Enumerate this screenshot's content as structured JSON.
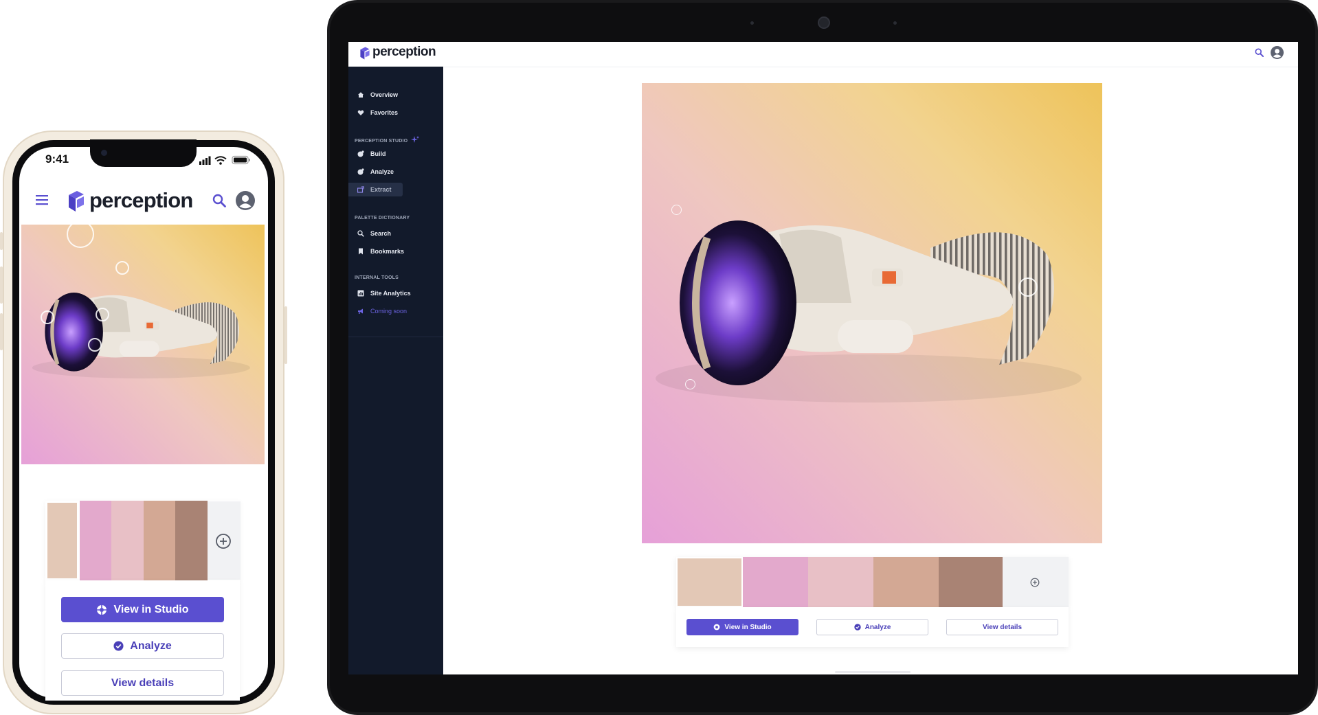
{
  "phone": {
    "status_time": "9:41",
    "brand": "perception",
    "icons": {
      "menu": "hamburger-menu-icon",
      "search": "search-icon",
      "avatar": "user-avatar-icon"
    },
    "palette": [
      "#e3c8b6",
      "#e3a9cc",
      "#e8c0c6",
      "#d3a894",
      "#a98374"
    ],
    "add_swatch_icon": "plus-circle-icon",
    "buttons": {
      "view_in_studio": "View in Studio",
      "analyze": "Analyze",
      "view_details": "View details"
    }
  },
  "tablet": {
    "brand": "perception",
    "icons": {
      "search": "search-icon",
      "avatar": "user-avatar-icon"
    },
    "sidebar": {
      "top_items": [
        {
          "label": "Overview",
          "icon": "home-icon"
        },
        {
          "label": "Favorites",
          "icon": "heart-icon"
        }
      ],
      "studio_section": "PERCEPTION STUDIO",
      "studio_items": [
        {
          "label": "Build",
          "icon": "palette-icon"
        },
        {
          "label": "Analyze",
          "icon": "palette-icon"
        },
        {
          "label": "Extract",
          "icon": "extract-icon",
          "active": true
        }
      ],
      "dictionary_section": "PALETTE DICTIONARY",
      "dictionary_items": [
        {
          "label": "Search",
          "icon": "search-icon"
        },
        {
          "label": "Bookmarks",
          "icon": "bookmark-icon"
        }
      ],
      "tools_section": "INTERNAL TOOLS",
      "tools_items": [
        {
          "label": "Site Analytics",
          "icon": "analytics-icon"
        },
        {
          "label": "Coming soon",
          "icon": "megaphone-icon"
        }
      ]
    },
    "palette": [
      "#e3c8b6",
      "#e3a9cc",
      "#e8c0c6",
      "#d3a894",
      "#a98374"
    ],
    "add_swatch_icon": "plus-circle-icon",
    "buttons": {
      "view_in_studio": "View in Studio",
      "analyze": "Analyze",
      "view_details": "View details"
    }
  },
  "colors": {
    "accent": "#5a4fd0",
    "sidebar_bg": "#121a2b",
    "coming_soon": "#6b63e0"
  }
}
